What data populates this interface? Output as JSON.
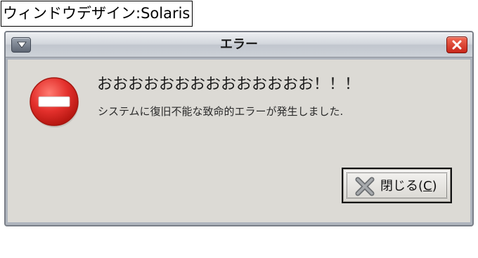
{
  "caption": "ウィンドウデザイン:Solaris",
  "window": {
    "title": "エラー",
    "menu_icon": "chevron-down-icon",
    "close_icon": "close-x-icon"
  },
  "dialog": {
    "icon": "error-stop-icon",
    "primary_text": "おおおおおおおおおおおおおお！！！",
    "secondary_text": "システムに復旧不能な致命的エラーが発生しました."
  },
  "button": {
    "icon": "close-x-icon",
    "label_prefix": "閉じる(",
    "mnemonic": "C",
    "label_suffix": ")"
  },
  "colors": {
    "titlebar": "#c9cdd4",
    "client": "#dcdad5",
    "close_button": "#d93a2a",
    "error_icon": "#e02a28"
  }
}
